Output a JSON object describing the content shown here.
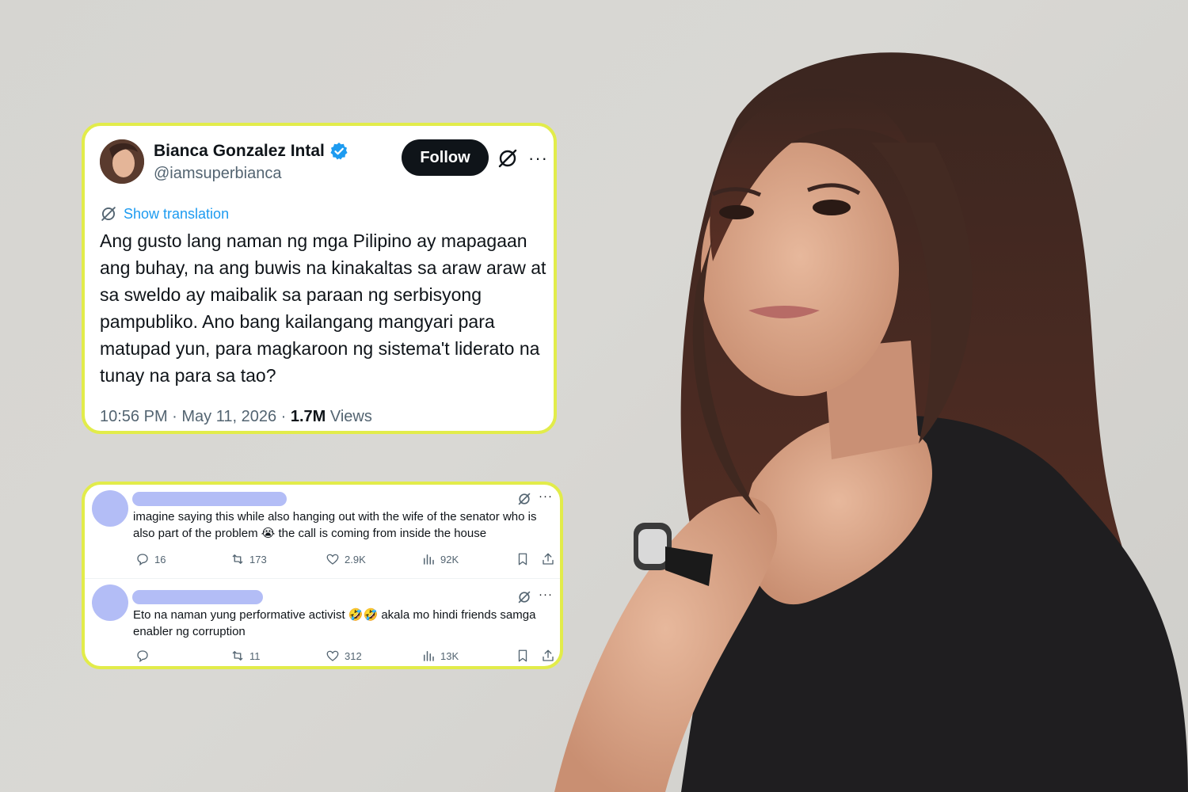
{
  "tweet": {
    "author_name": "Bianca Gonzalez Intal",
    "handle": "@iamsuperbianca",
    "follow_label": "Follow",
    "more_label": "···",
    "show_translation": "Show translation",
    "text": "Ang gusto lang naman ng mga Pilipino ay mapagaan ang buhay, na ang buwis na kinakaltas sa araw araw at sa sweldo ay maibalik sa paraan ng serbisyong pampubliko. Ano bang kailangang mangyari para matupad yun, para magkaroon ng sistema't liderato na tunay na para sa tao?",
    "time": "10:56 PM · May 11, 2026 · ",
    "views_count": "1.7M",
    "views_label": " Views",
    "verified_color": "#1d9bf0"
  },
  "replies": [
    {
      "text": "imagine saying this while also hanging out with the wife of the senator who is also part of the problem 😭 the call is coming from inside the house",
      "more_label": "···",
      "replies": "16",
      "reposts": "173",
      "likes": "2.9K",
      "views": "92K"
    },
    {
      "text": "Eto na naman yung performative activist 🤣🤣 akala mo hindi friends samga enabler ng corruption",
      "more_label": "···",
      "replies": "",
      "reposts": "11",
      "likes": "312",
      "views": "13K"
    }
  ],
  "colors": {
    "card_border": "#e2ec4a",
    "redacted": "#b3bdf6",
    "link": "#1d9bf0"
  }
}
